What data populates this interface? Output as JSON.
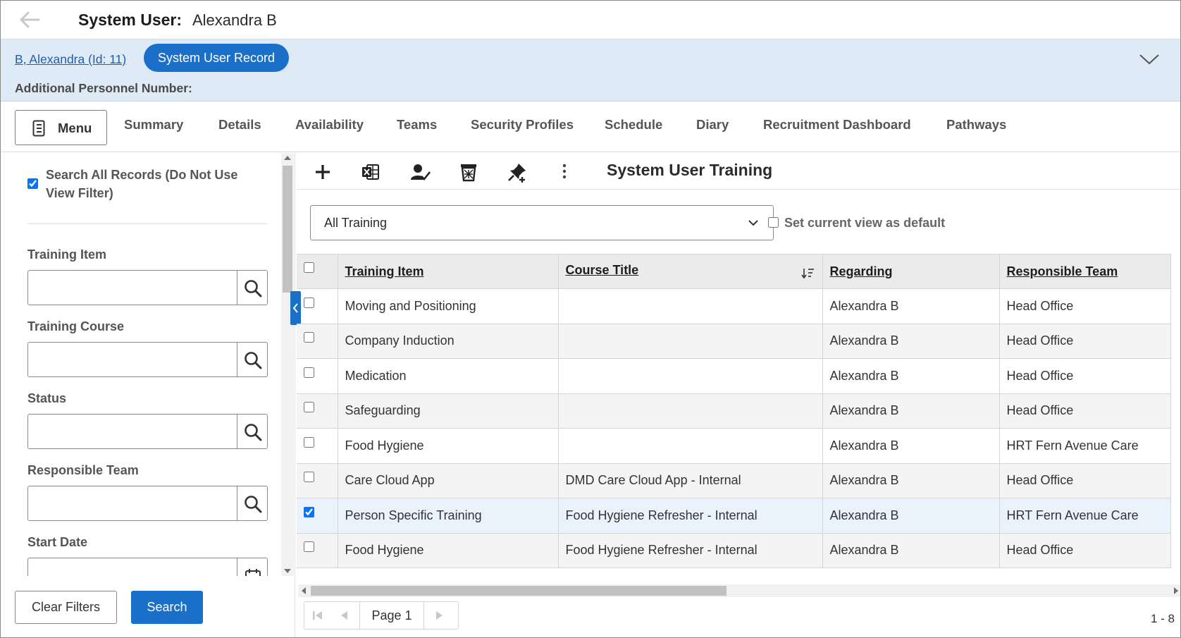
{
  "header": {
    "title_label": "System User:",
    "title_value": "Alexandra B"
  },
  "record": {
    "link_text": "B, Alexandra (Id: 11)",
    "pill_label": "System User Record",
    "additional_label": "Additional Personnel Number:"
  },
  "nav": {
    "menu_label": "Menu",
    "tabs": [
      "Summary",
      "Details",
      "Availability",
      "Teams",
      "Security Profiles",
      "Schedule",
      "Diary",
      "Recruitment Dashboard",
      "Pathways"
    ]
  },
  "filters": {
    "search_all_label": "Search All Records (Do Not Use View Filter)",
    "search_all_checked": true,
    "fields": [
      "Training Item",
      "Training Course",
      "Status",
      "Responsible Team",
      "Start Date"
    ],
    "clear_label": "Clear Filters",
    "search_label": "Search"
  },
  "toolbar": {
    "icons": [
      "add-icon",
      "excel-export-icon",
      "assign-user-icon",
      "delete-icon",
      "pin-icon",
      "more-icon"
    ],
    "section_title": "System User Training"
  },
  "view": {
    "selected": "All Training",
    "default_label": "Set current view as default",
    "default_checked": false
  },
  "grid": {
    "columns": [
      "Training Item",
      "Course Title",
      "Regarding",
      "Responsible Team"
    ],
    "rows": [
      {
        "training_item": "Moving and Positioning",
        "course_title": "",
        "regarding": "Alexandra B",
        "team": "Head Office",
        "checked": false
      },
      {
        "training_item": "Company Induction",
        "course_title": "",
        "regarding": "Alexandra B",
        "team": "Head Office",
        "checked": false
      },
      {
        "training_item": "Medication",
        "course_title": "",
        "regarding": "Alexandra B",
        "team": "Head Office",
        "checked": false
      },
      {
        "training_item": "Safeguarding",
        "course_title": "",
        "regarding": "Alexandra B",
        "team": "Head Office",
        "checked": false
      },
      {
        "training_item": "Food Hygiene",
        "course_title": "",
        "regarding": "Alexandra B",
        "team": "HRT Fern Avenue Care",
        "checked": false
      },
      {
        "training_item": "Care Cloud App",
        "course_title": "DMD Care Cloud App - Internal",
        "regarding": "Alexandra B",
        "team": "Head Office",
        "checked": false
      },
      {
        "training_item": "Person Specific Training",
        "course_title": "Food Hygiene Refresher - Internal",
        "regarding": "Alexandra B",
        "team": "HRT Fern Avenue Care",
        "checked": true
      },
      {
        "training_item": "Food Hygiene",
        "course_title": "Food Hygiene Refresher - Internal",
        "regarding": "Alexandra B",
        "team": "Head Office",
        "checked": false
      }
    ]
  },
  "pager": {
    "page_label": "Page 1",
    "range_label": "1 - 8"
  },
  "colors": {
    "accent": "#1a70c9",
    "band": "#deeaf5"
  }
}
